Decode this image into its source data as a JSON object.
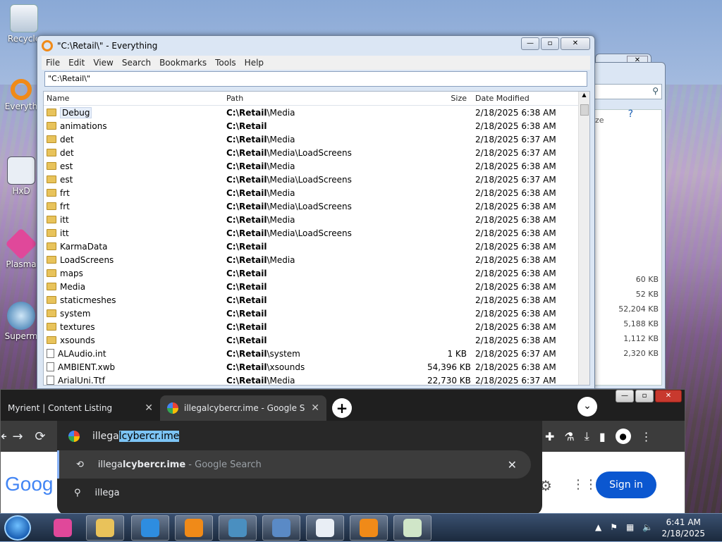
{
  "desktop": {
    "icons": [
      {
        "label": "Recycle",
        "color": "#dfe8f2"
      },
      {
        "label": "Everyth",
        "color": "#f08a18"
      },
      {
        "label": "HxD",
        "color": "#e9eef5"
      },
      {
        "label": "Plasma",
        "color": "#e0489a"
      },
      {
        "label": "Superm",
        "color": "#4a8fc0"
      }
    ]
  },
  "everything": {
    "title": "\"C:\\Retail\\\" - Everything",
    "menu": [
      "File",
      "Edit",
      "View",
      "Search",
      "Bookmarks",
      "Tools",
      "Help"
    ],
    "search_value": "\"C:\\Retail\\\"",
    "columns": {
      "name": "Name",
      "path": "Path",
      "size": "Size",
      "date": "Date Modified"
    },
    "rows": [
      {
        "type": "folder",
        "name": "Debug",
        "path_bold": "C:\\Retail",
        "path_rest": "\\Media",
        "size": "",
        "date": "2/18/2025 6:38 AM"
      },
      {
        "type": "folder",
        "name": "animations",
        "path_bold": "C:\\Retail",
        "path_rest": "",
        "size": "",
        "date": "2/18/2025 6:38 AM"
      },
      {
        "type": "folder",
        "name": "det",
        "path_bold": "C:\\Retail",
        "path_rest": "\\Media",
        "size": "",
        "date": "2/18/2025 6:37 AM"
      },
      {
        "type": "folder",
        "name": "det",
        "path_bold": "C:\\Retail",
        "path_rest": "\\Media\\LoadScreens",
        "size": "",
        "date": "2/18/2025 6:37 AM"
      },
      {
        "type": "folder",
        "name": "est",
        "path_bold": "C:\\Retail",
        "path_rest": "\\Media",
        "size": "",
        "date": "2/18/2025 6:38 AM"
      },
      {
        "type": "folder",
        "name": "est",
        "path_bold": "C:\\Retail",
        "path_rest": "\\Media\\LoadScreens",
        "size": "",
        "date": "2/18/2025 6:37 AM"
      },
      {
        "type": "folder",
        "name": "frt",
        "path_bold": "C:\\Retail",
        "path_rest": "\\Media",
        "size": "",
        "date": "2/18/2025 6:38 AM"
      },
      {
        "type": "folder",
        "name": "frt",
        "path_bold": "C:\\Retail",
        "path_rest": "\\Media\\LoadScreens",
        "size": "",
        "date": "2/18/2025 6:38 AM"
      },
      {
        "type": "folder",
        "name": "itt",
        "path_bold": "C:\\Retail",
        "path_rest": "\\Media",
        "size": "",
        "date": "2/18/2025 6:38 AM"
      },
      {
        "type": "folder",
        "name": "itt",
        "path_bold": "C:\\Retail",
        "path_rest": "\\Media\\LoadScreens",
        "size": "",
        "date": "2/18/2025 6:38 AM"
      },
      {
        "type": "folder",
        "name": "KarmaData",
        "path_bold": "C:\\Retail",
        "path_rest": "",
        "size": "",
        "date": "2/18/2025 6:38 AM"
      },
      {
        "type": "folder",
        "name": "LoadScreens",
        "path_bold": "C:\\Retail",
        "path_rest": "\\Media",
        "size": "",
        "date": "2/18/2025 6:38 AM"
      },
      {
        "type": "folder",
        "name": "maps",
        "path_bold": "C:\\Retail",
        "path_rest": "",
        "size": "",
        "date": "2/18/2025 6:38 AM"
      },
      {
        "type": "folder",
        "name": "Media",
        "path_bold": "C:\\Retail",
        "path_rest": "",
        "size": "",
        "date": "2/18/2025 6:38 AM"
      },
      {
        "type": "folder",
        "name": "staticmeshes",
        "path_bold": "C:\\Retail",
        "path_rest": "",
        "size": "",
        "date": "2/18/2025 6:38 AM"
      },
      {
        "type": "folder",
        "name": "system",
        "path_bold": "C:\\Retail",
        "path_rest": "",
        "size": "",
        "date": "2/18/2025 6:38 AM"
      },
      {
        "type": "folder",
        "name": "textures",
        "path_bold": "C:\\Retail",
        "path_rest": "",
        "size": "",
        "date": "2/18/2025 6:38 AM"
      },
      {
        "type": "folder",
        "name": "xsounds",
        "path_bold": "C:\\Retail",
        "path_rest": "",
        "size": "",
        "date": "2/18/2025 6:38 AM"
      },
      {
        "type": "file",
        "name": "ALAudio.int",
        "path_bold": "C:\\Retail",
        "path_rest": "\\system",
        "size": "1 KB",
        "date": "2/18/2025 6:37 AM"
      },
      {
        "type": "file",
        "name": "AMBIENT.xwb",
        "path_bold": "C:\\Retail",
        "path_rest": "\\xsounds",
        "size": "54,396 KB",
        "date": "2/18/2025 6:38 AM"
      },
      {
        "type": "file",
        "name": "ArialUni.Ttf",
        "path_bold": "C:\\Retail",
        "path_rest": "\\Media",
        "size": "22,730 KB",
        "date": "2/18/2025 6:37 AM"
      }
    ]
  },
  "background_window": {
    "size_header": "ze",
    "sizes": [
      "60 KB",
      "52 KB",
      "52,204 KB",
      "5,188 KB",
      "1,112 KB",
      "2,320 KB"
    ]
  },
  "chrome": {
    "tabs": [
      {
        "label": "Myrient | Content Listing"
      },
      {
        "label": "illegalcybercr.ime - Google Search"
      }
    ],
    "omnibox_typed": "illega",
    "omnibox_autocomplete": "lcybercr.ime",
    "suggestions": [
      {
        "prefix": "illega",
        "completion": "lcybercr.ime",
        "suffix": " - Google Search"
      },
      {
        "prefix": "illega",
        "completion": "",
        "suffix": ""
      }
    ],
    "page": {
      "logo": "Goog",
      "signin": "Sign in"
    }
  },
  "taskbar": {
    "items": [
      {
        "name": "plasma",
        "color": "#e0489a"
      },
      {
        "name": "explorer",
        "color": "#e9c25a"
      },
      {
        "name": "ie",
        "color": "#2e8de0"
      },
      {
        "name": "vlc",
        "color": "#f08a18"
      },
      {
        "name": "supermium",
        "color": "#4a8fc0"
      },
      {
        "name": "control",
        "color": "#5a8ac6"
      },
      {
        "name": "hxd",
        "color": "#e9eef5"
      },
      {
        "name": "everything",
        "color": "#f08a18"
      },
      {
        "name": "paint",
        "color": "#d0e6c8"
      }
    ],
    "time": "6:41 AM",
    "date": "2/18/2025"
  }
}
